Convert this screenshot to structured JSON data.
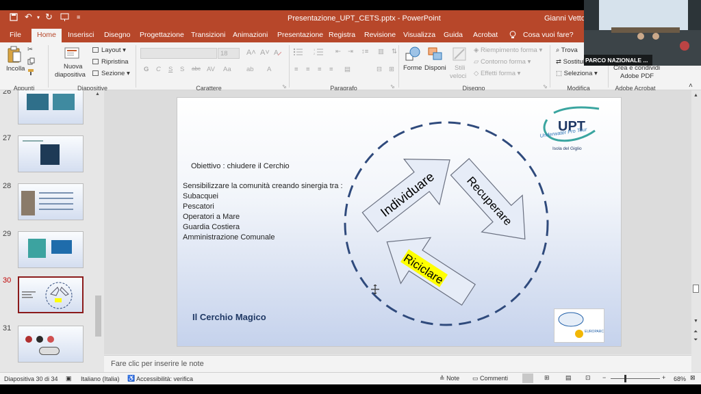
{
  "window": {
    "title": "Presentazione_UPT_CETS.pptx - PowerPoint",
    "user": "Gianni Vettore"
  },
  "menu": {
    "tabs": [
      "File",
      "Home",
      "Inserisci",
      "Disegno",
      "Progettazione",
      "Transizioni",
      "Animazioni",
      "Presentazione",
      "Registra",
      "Revisione",
      "Visualizza",
      "Guida",
      "Acrobat"
    ],
    "active": "Home",
    "tell_me": "Cosa vuoi fare?"
  },
  "ribbon": {
    "paste": "Incolla",
    "new_slide_1": "Nuova",
    "new_slide_2": "diapositiva",
    "layout": "Layout",
    "reset": "Ripristina",
    "section": "Sezione",
    "font_size": "18",
    "bold": "G",
    "italic": "C",
    "underline": "S",
    "shadow": "S",
    "strike": "abc",
    "shapes": "Forme",
    "arrange": "Disponi",
    "quick_styles_1": "Stili",
    "quick_styles_2": "veloci",
    "shape_fill": "Riempimento forma",
    "shape_outline": "Contorno forma",
    "shape_effects": "Effetti forma",
    "find": "Trova",
    "replace": "Sostitui",
    "select": "Seleziona",
    "acrobat_1": "Crea e condividi",
    "acrobat_2": "Adobe PDF",
    "groups": {
      "clipboard": "Appunti",
      "slides": "Diapositive",
      "font": "Carattere",
      "paragraph": "Paragrafo",
      "drawing": "Disegno",
      "editing": "Modifica",
      "acrobat": "Adobe Acrobat"
    }
  },
  "thumbnails": [
    {
      "num": "26",
      "selected": false
    },
    {
      "num": "27",
      "selected": false
    },
    {
      "num": "28",
      "selected": false
    },
    {
      "num": "29",
      "selected": false
    },
    {
      "num": "30",
      "selected": true
    },
    {
      "num": "31",
      "selected": false
    }
  ],
  "slide": {
    "objective": "Obiettivo : chiudere il Cerchio",
    "intro": "Sensibilizzare la comunità creando sinergia tra :",
    "list": [
      "Subacquei",
      "Pescatori",
      "Operatori a Mare",
      "Guardia Costiera",
      "Amministrazione Comunale"
    ],
    "footer_title": "Il Cerchio Magico",
    "arrows": {
      "a1": "Individuare",
      "a2": "Recuperare",
      "a3": "Riciclare"
    },
    "logo_text": "UPT",
    "logo_sub": "Underwater Pro Tour",
    "logo_place": "Isola del Giglio",
    "europarc": "EUROPARC",
    "colors": {
      "circle": "#2f4a7c",
      "highlight": "#ffff00",
      "title": "#1f3864"
    }
  },
  "notes_placeholder": "Fare clic per inserire le note",
  "status": {
    "slide_counter": "Diapositiva 30 di 34",
    "language": "Italiano (Italia)",
    "accessibility": "Accessibilità: verifica",
    "notes": "Note",
    "comments": "Commenti",
    "zoom": "68%"
  },
  "video": {
    "label": "PARCO NAZIONALE ..."
  }
}
